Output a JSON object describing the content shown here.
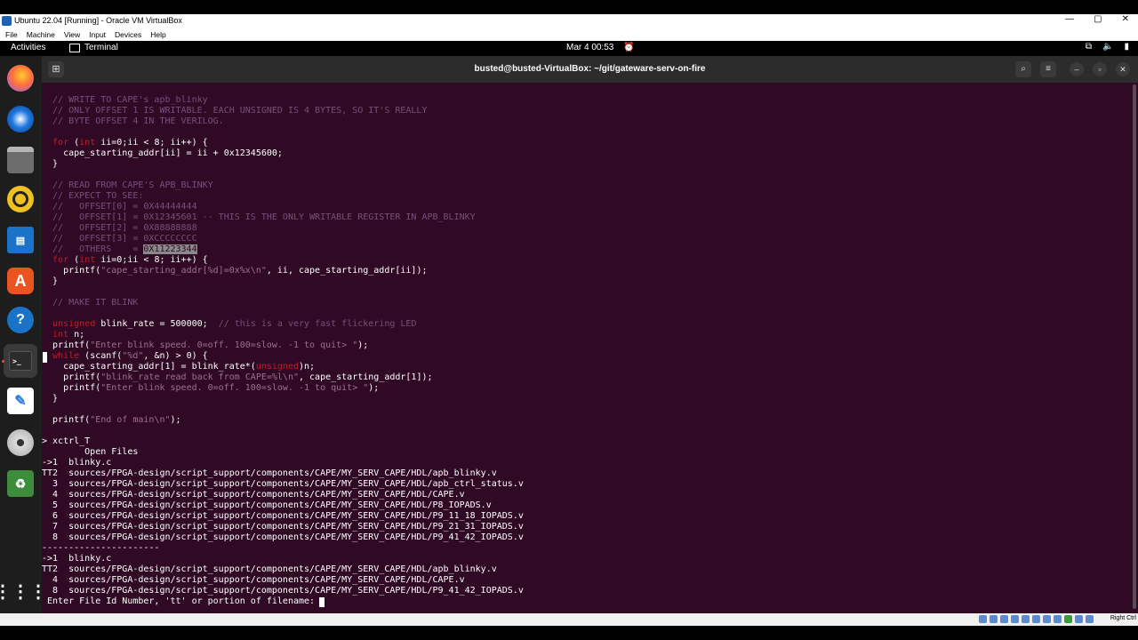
{
  "vbox": {
    "title": "Ubuntu 22.04 [Running] - Oracle VM VirtualBox",
    "menu": [
      "File",
      "Machine",
      "View",
      "Input",
      "Devices",
      "Help"
    ],
    "status_host_key": "Right Ctrl",
    "window_controls": [
      "—",
      "▢",
      "✕"
    ]
  },
  "topbar": {
    "activities": "Activities",
    "app": "Terminal",
    "clock": "Mar 4  00:53"
  },
  "dock": {
    "items": [
      "firefox-icon",
      "thunderbird-icon",
      "files-icon",
      "rhythmbox-icon",
      "writer-icon",
      "app-center-icon",
      "help-icon",
      "terminal-icon",
      "text-editor-icon",
      "disc-icon",
      "trash-icon",
      "show-apps-icon"
    ],
    "accent": "#e95420"
  },
  "terminal": {
    "title": "busted@busted-VirtualBox: ~/git/gateware-serv-on-fire",
    "background": "#300a24"
  },
  "code": {
    "l0": "  // WRITE TO CAPE's apb_blinky",
    "l1": "  // ONLY OFFSET 1 IS WRITABLE. EACH UNSIGNED IS 4 BYTES, SO IT'S REALLY",
    "l2": "  // BYTE OFFSET 4 IN THE VERILOG.",
    "l4a": "for",
    "l4b": " (",
    "l4c": "int",
    "l4d": " ii=0;ii < 8; ii++) {",
    "l5": "    cape_starting_addr[ii] = ii + 0x12345600;",
    "l6": "  }",
    "l8": "  // READ FROM CAPE'S APB_BLINKY",
    "l9": "  // EXPECT TO SEE:",
    "l10": "  //   OFFSET[0] = 0X44444444",
    "l11": "  //   OFFSET[1] = 0X12345601 -- THIS IS THE ONLY WRITABLE REGISTER IN APB_BLINKY",
    "l12": "  //   OFFSET[2] = 0X88888888",
    "l13": "  //   OFFSET[3] = 0XCCCCCCCC",
    "l14a": "  //   OTHERS    = ",
    "l14b": "0X11223344",
    "l15a": "for",
    "l15b": " (",
    "l15c": "int",
    "l15d": " ii=0;ii < 8; ii++) {",
    "l16a": "    printf(",
    "l16b": "\"cape_starting_addr[%d]=0x%x\\n\"",
    "l16c": ", ii, cape_starting_addr[ii]);",
    "l17": "  }",
    "l19": "  // MAKE IT BLINK",
    "l21a": "unsigned",
    "l21b": " blink_rate = 500000;  ",
    "l21c": "// this is a very fast flickering LED",
    "l22a": "int",
    "l22b": " n;",
    "l23a": "  printf(",
    "l23b": "\"Enter blink speed. 0=off. 100=slow. -1 to quit> \"",
    "l23c": ");",
    "l24a": "while",
    "l24b": " (scanf(",
    "l24c": "\"%d\"",
    "l24d": ", &n) > 0) {",
    "l25a": "    cape_starting_addr[1] = blink_rate*(",
    "l25b": "unsigned",
    "l25c": ")n;",
    "l26a": "    printf(",
    "l26b": "\"blink_rate read back from CAPE=%l\\n\"",
    "l26c": ", cape_starting_addr[1]);",
    "l27a": "    printf(",
    "l27b": "\"Enter blink speed. 0=off. 100=slow. -1 to quit> \"",
    "l27c": ");",
    "l28": "  }",
    "l30a": "  printf(",
    "l30b": "\"End of main\\n\"",
    "l30c": ");"
  },
  "files": {
    "cmd": "> xctrl_T",
    "header": "        Open Files",
    "list": [
      "->1  blinky.c",
      "TT2  sources/FPGA-design/script_support/components/CAPE/MY_SERV_CAPE/HDL/apb_blinky.v",
      "  3  sources/FPGA-design/script_support/components/CAPE/MY_SERV_CAPE/HDL/apb_ctrl_status.v",
      "  4  sources/FPGA-design/script_support/components/CAPE/MY_SERV_CAPE/HDL/CAPE.v",
      "  5  sources/FPGA-design/script_support/components/CAPE/MY_SERV_CAPE/HDL/P8_IOPADS.v",
      "  6  sources/FPGA-design/script_support/components/CAPE/MY_SERV_CAPE/HDL/P9_11_18_IOPADS.v",
      "  7  sources/FPGA-design/script_support/components/CAPE/MY_SERV_CAPE/HDL/P9_21_31_IOPADS.v",
      "  8  sources/FPGA-design/script_support/components/CAPE/MY_SERV_CAPE/HDL/P9_41_42_IOPADS.v"
    ],
    "separator": "----------------------",
    "filtered": [
      "->1  blinky.c",
      "TT2  sources/FPGA-design/script_support/components/CAPE/MY_SERV_CAPE/HDL/apb_blinky.v",
      "  4  sources/FPGA-design/script_support/components/CAPE/MY_SERV_CAPE/HDL/CAPE.v",
      "  8  sources/FPGA-design/script_support/components/CAPE/MY_SERV_CAPE/HDL/P9_41_42_IOPADS.v"
    ],
    "prompt": " Enter File Id Number, 'tt' or portion of filename: "
  }
}
